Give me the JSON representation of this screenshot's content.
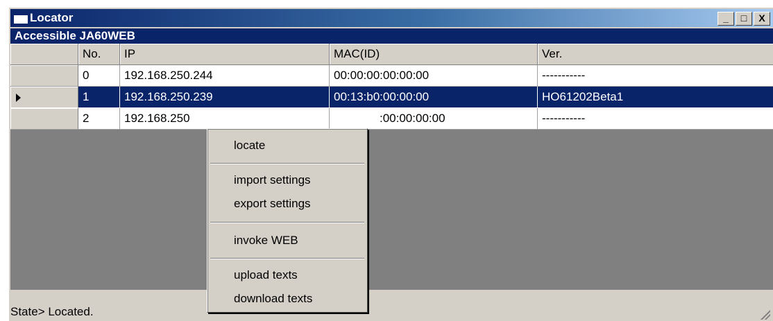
{
  "window": {
    "title": "Locator",
    "buttons": [
      "_",
      "□",
      "X"
    ]
  },
  "banner": {
    "text": "Accessible JA60WEB"
  },
  "table": {
    "columns": [
      "No.",
      "IP",
      "MAC(ID)",
      "Ver."
    ],
    "rows": [
      {
        "no": "0",
        "ip": "192.168.250.244",
        "mac": "00:00:00:00:00:00",
        "ver": "-----------"
      },
      {
        "no": "1",
        "ip": "192.168.250.239",
        "mac": "00:13:b0:00:00:00",
        "ver": "HO61202Beta1"
      },
      {
        "no": "2",
        "ip": "192.168.250",
        "mac": ":00:00:00:00",
        "ver": "-----------"
      }
    ],
    "selected_row": 1
  },
  "context_menu": {
    "items": [
      "locate",
      "import settings",
      "export settings",
      "invoke WEB",
      "upload texts",
      "download texts"
    ]
  },
  "status": {
    "text": "State> Located."
  },
  "colors": {
    "title_gradient_start": "#0a246a",
    "selection": "#0a246a",
    "face": "#d4d0c8",
    "grid_bg": "#808080"
  }
}
